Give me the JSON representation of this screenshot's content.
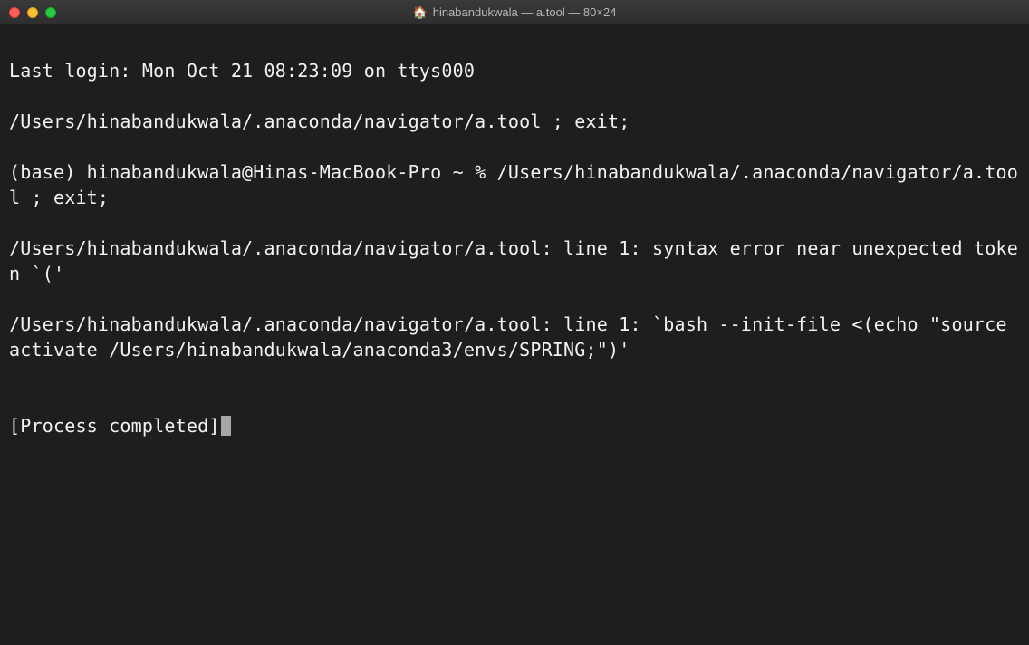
{
  "window": {
    "title": "hinabandukwala — a.tool — 80×24"
  },
  "terminal": {
    "lines": [
      "Last login: Mon Oct 21 08:23:09 on ttys000",
      "/Users/hinabandukwala/.anaconda/navigator/a.tool ; exit;",
      "(base) hinabandukwala@Hinas-MacBook-Pro ~ % /Users/hinabandukwala/.anaconda/navigator/a.tool ; exit;",
      "/Users/hinabandukwala/.anaconda/navigator/a.tool: line 1: syntax error near unexpected token `('",
      "/Users/hinabandukwala/.anaconda/navigator/a.tool: line 1: `bash --init-file <(echo \"source activate /Users/hinabandukwala/anaconda3/envs/SPRING;\")'",
      ""
    ],
    "status": "[Process completed]"
  }
}
